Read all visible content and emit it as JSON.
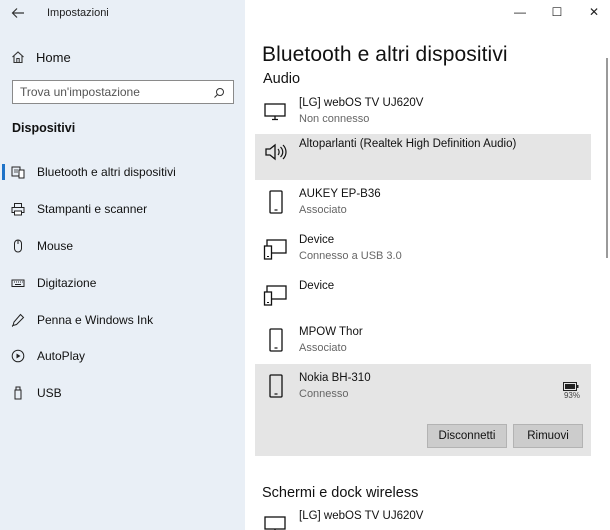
{
  "window": {
    "app_title": "Impostazioni",
    "minimize": "—",
    "maximize": "☐",
    "close": "✕"
  },
  "sidebar": {
    "home_label": "Home",
    "search_placeholder": "Trova un'impostazione",
    "section_title": "Dispositivi",
    "items": [
      {
        "label": "Bluetooth e altri dispositivi",
        "icon": "bluetooth-devices-icon",
        "selected": true
      },
      {
        "label": "Stampanti e scanner",
        "icon": "printer-icon",
        "selected": false
      },
      {
        "label": "Mouse",
        "icon": "mouse-icon",
        "selected": false
      },
      {
        "label": "Digitazione",
        "icon": "keyboard-icon",
        "selected": false
      },
      {
        "label": "Penna e Windows Ink",
        "icon": "pen-icon",
        "selected": false
      },
      {
        "label": "AutoPlay",
        "icon": "autoplay-icon",
        "selected": false
      },
      {
        "label": "USB",
        "icon": "usb-icon",
        "selected": false
      }
    ]
  },
  "main": {
    "page_title": "Bluetooth e altri dispositivi",
    "audio_heading": "Audio",
    "devices": [
      {
        "name": "[LG] webOS TV UJ620V",
        "status": "Non connesso",
        "icon": "monitor-icon"
      },
      {
        "name": "Altoparlanti (Realtek High Definition Audio)",
        "status": "",
        "icon": "speaker-icon"
      },
      {
        "name": "AUKEY EP-B36",
        "status": "Associato",
        "icon": "phone-icon"
      },
      {
        "name": "Device",
        "status": "Connesso a USB 3.0",
        "icon": "devices-icon"
      },
      {
        "name": "Device",
        "status": "",
        "icon": "devices-icon"
      },
      {
        "name": "MPOW Thor",
        "status": "Associato",
        "icon": "phone-icon"
      },
      {
        "name": "Nokia BH-310",
        "status": "Connesso",
        "icon": "phone-icon"
      }
    ],
    "battery_percent": "93%",
    "disconnect_label": "Disconnetti",
    "remove_label": "Rimuovi",
    "wireless_heading": "Schermi e dock wireless",
    "wireless_devices": [
      {
        "name": "[LG] webOS TV UJ620V",
        "icon": "monitor-icon"
      }
    ]
  }
}
